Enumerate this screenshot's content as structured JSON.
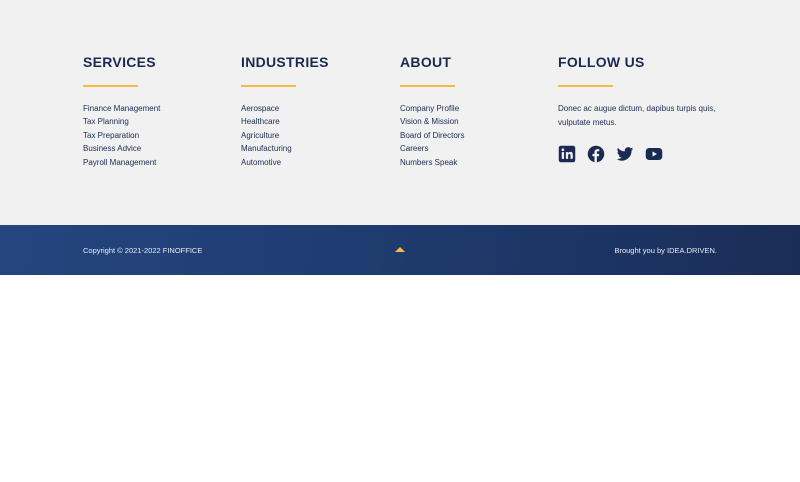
{
  "services": {
    "title": "SERVICES",
    "items": [
      "Finance Management",
      "Tax Planning",
      "Tax Preparation",
      "Business Advice",
      "Payroll Management"
    ]
  },
  "industries": {
    "title": "INDUSTRIES",
    "items": [
      "Aerospace",
      "Healthcare",
      "Agriculture",
      "Manufacturing",
      "Automotive"
    ]
  },
  "about": {
    "title": "ABOUT",
    "items": [
      "Company Profile",
      "Vision & Mission",
      "Board of Directors",
      "Careers",
      "Numbers Speak"
    ]
  },
  "follow": {
    "title": "FOLLOW US",
    "text": "Donec ac augue dictum, dapibus turpis quis, vulputate metus.",
    "icons": [
      "linkedin-icon",
      "facebook-icon",
      "twitter-icon",
      "youtube-icon"
    ]
  },
  "bottom": {
    "copyright": "Copyright © 2021-2022 FINOFFICE",
    "credit": "Brought you by IDEA.DRIVEN."
  },
  "colors": {
    "accent": "#f6b944",
    "navy": "#1b2a52",
    "bar": "#24467e"
  }
}
